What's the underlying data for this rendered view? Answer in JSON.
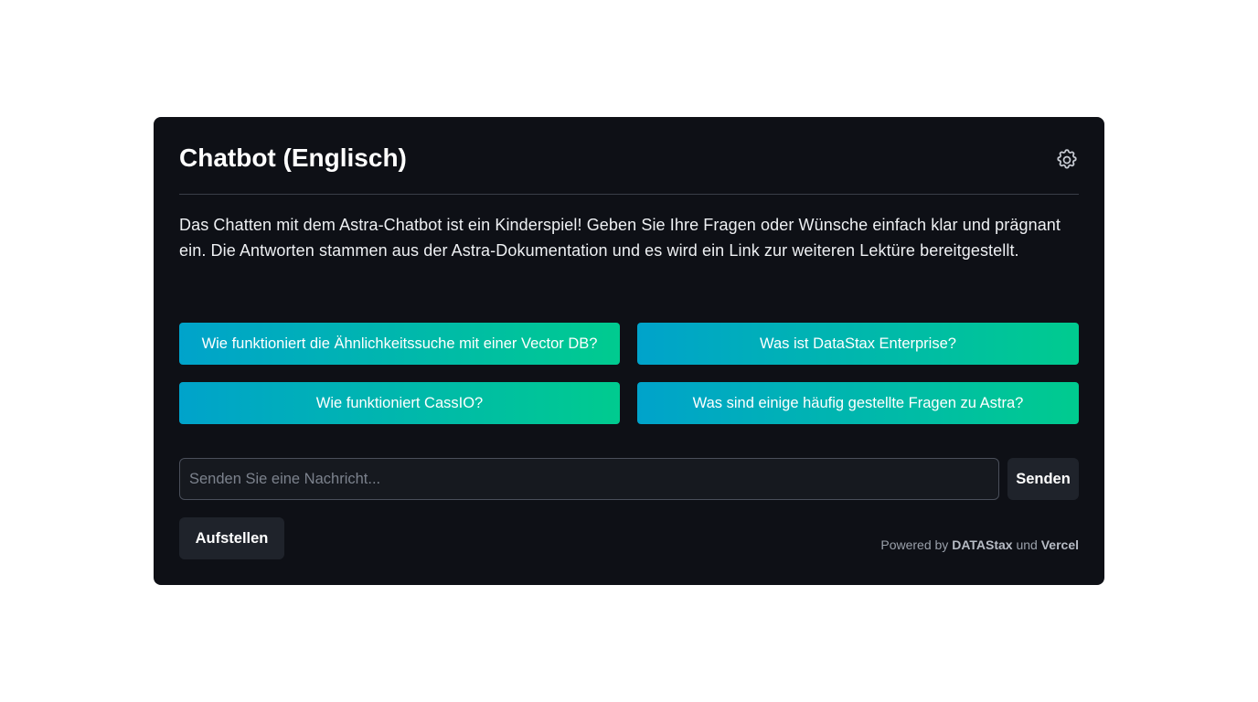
{
  "header": {
    "title": "Chatbot (Englisch)",
    "settings_icon": "gear-icon"
  },
  "intro": {
    "text": "Das Chatten mit dem Astra-Chatbot ist ein Kinderspiel! Geben Sie Ihre Fragen oder Wünsche einfach klar und prägnant ein. Die Antworten stammen aus der Astra-Dokumentation und es wird ein Link zur weiteren Lektüre bereitgestellt."
  },
  "suggestions": [
    {
      "label": "Wie funktioniert die Ähnlichkeitssuche mit einer Vector DB?"
    },
    {
      "label": "Was ist DataStax Enterprise?"
    },
    {
      "label": "Wie funktioniert CassIO?"
    },
    {
      "label": "Was sind einige häufig gestellte Fragen zu Astra?"
    }
  ],
  "composer": {
    "placeholder": "Senden Sie eine Nachricht...",
    "value": "",
    "send_label": "Senden"
  },
  "footer": {
    "setup_label": "Aufstellen",
    "powered_prefix": "Powered by",
    "brand1": "DATAStax",
    "conjunction": "und",
    "brand2": "Vercel"
  },
  "colors": {
    "card_bg": "#0e1016",
    "gradient_start": "#00a3cb",
    "gradient_end": "#00cb8f",
    "button_bg": "#1f232b"
  }
}
